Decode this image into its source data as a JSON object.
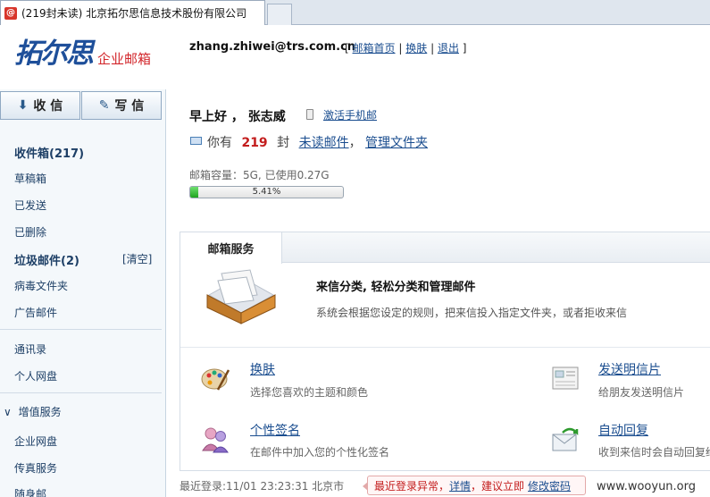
{
  "browser": {
    "tab_icon": "@",
    "tab_title": "(219封未读) 北京拓尔思信息技术股份有限公司"
  },
  "header": {
    "logo_main": "拓尔思",
    "logo_sub": "企业邮箱",
    "email": "zhang.zhiwei@trs.com.cn",
    "link_open": "[",
    "link_home": "邮箱首页",
    "link_skin": "换肤",
    "link_logout": "退出",
    "link_close": "]",
    "sep": "|"
  },
  "sidebar": {
    "receive_label": "收 信",
    "compose_label": "写 信",
    "items": [
      {
        "label": "收件箱(217)"
      },
      {
        "label": "草稿箱"
      },
      {
        "label": "已发送"
      },
      {
        "label": "已删除"
      },
      {
        "label": "垃圾邮件(2)"
      },
      {
        "label": "病毒文件夹"
      },
      {
        "label": "广告邮件"
      },
      {
        "label": "通讯录"
      },
      {
        "label": "个人网盘"
      },
      {
        "label": "增值服务"
      },
      {
        "label": "企业网盘"
      },
      {
        "label": "传真服务"
      },
      {
        "label": "随身邮"
      }
    ],
    "clear_label": "[清空]",
    "group_arrow": "∨"
  },
  "main": {
    "greeting": "早上好 ， 张志威",
    "activate_link": "激活手机邮",
    "unread_prefix": "你有",
    "unread_count": "219",
    "unread_unit": "封",
    "unread_link": "未读邮件",
    "comma": "，",
    "manage_link": "管理文件夹",
    "capacity": "邮箱容量：5G, 已使用0.27G",
    "usage_percent": 5.41,
    "usage_label": "5.41%",
    "panel_tab": "邮箱服务",
    "feature_title": "来信分类, 轻松分类和管理邮件",
    "feature_desc": "系统会根据您设定的规则，把来信投入指定文件夹，或者拒收来信",
    "services": [
      {
        "title": "换肤",
        "desc": "选择您喜欢的主题和颜色",
        "icon": "palette-icon"
      },
      {
        "title": "发送明信片",
        "desc": "给朋友发送明信片",
        "icon": "postcard-icon"
      },
      {
        "title": "个性签名",
        "desc": "在邮件中加入您的个性化签名",
        "icon": "signature-icon"
      },
      {
        "title": "自动回复",
        "desc": "收到来信时会自动回复给",
        "icon": "auto-reply-icon"
      }
    ],
    "last_login": "最近登录:11/01 23:23:31  北京市",
    "warning_text": "最近登录异常，",
    "warning_detail": "详情",
    "warning_mid": "，建议立即",
    "warning_change": "修改密码",
    "watermark": "www.wooyun.org"
  },
  "colors": {
    "brand_blue": "#1e4f9a",
    "brand_red": "#d2262b",
    "link": "#1a4d8f",
    "unread_red": "#c31c1c",
    "progress_green": "#2fb52f"
  }
}
